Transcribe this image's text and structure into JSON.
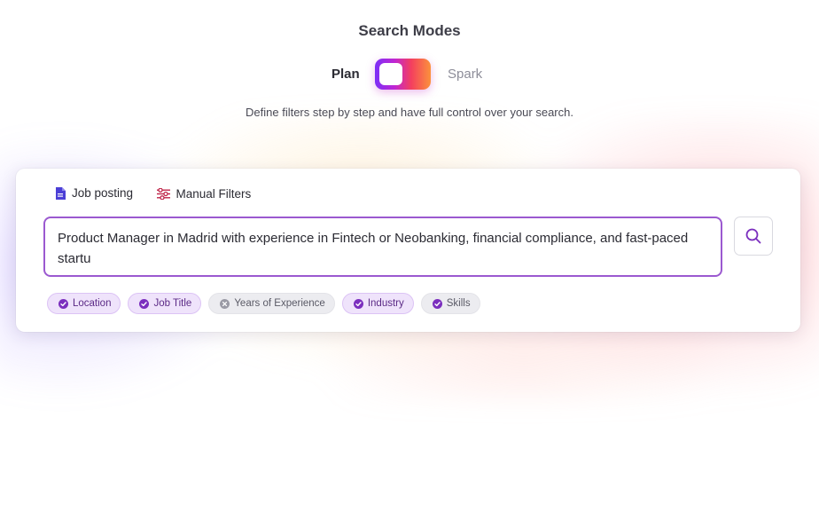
{
  "header": {
    "title": "Search Modes",
    "subtitle": "Define filters step by step and have full control over your search."
  },
  "mode_toggle": {
    "left_label": "Plan",
    "right_label": "Spark",
    "selected": "Plan"
  },
  "tabs": [
    {
      "label": "Job posting",
      "icon": "document-icon"
    },
    {
      "label": "Manual Filters",
      "icon": "sliders-icon"
    }
  ],
  "search": {
    "value": "Product Manager in Madrid with experience in Fintech or Neobanking, financial compliance, and fast-paced startu"
  },
  "chips": [
    {
      "label": "Location",
      "state": "checked"
    },
    {
      "label": "Job Title",
      "state": "checked"
    },
    {
      "label": "Years of Experience",
      "state": "unchecked"
    },
    {
      "label": "Industry",
      "state": "checked"
    },
    {
      "label": "Skills",
      "state": "checked"
    }
  ],
  "colors": {
    "accent": "#9b59d0",
    "chip_checked_icon": "#7b2fbe",
    "chip_unchecked_icon": "#9a9aa5",
    "tab_document_icon": "#4b3fd6",
    "tab_sliders_icon": "#c0264a"
  }
}
